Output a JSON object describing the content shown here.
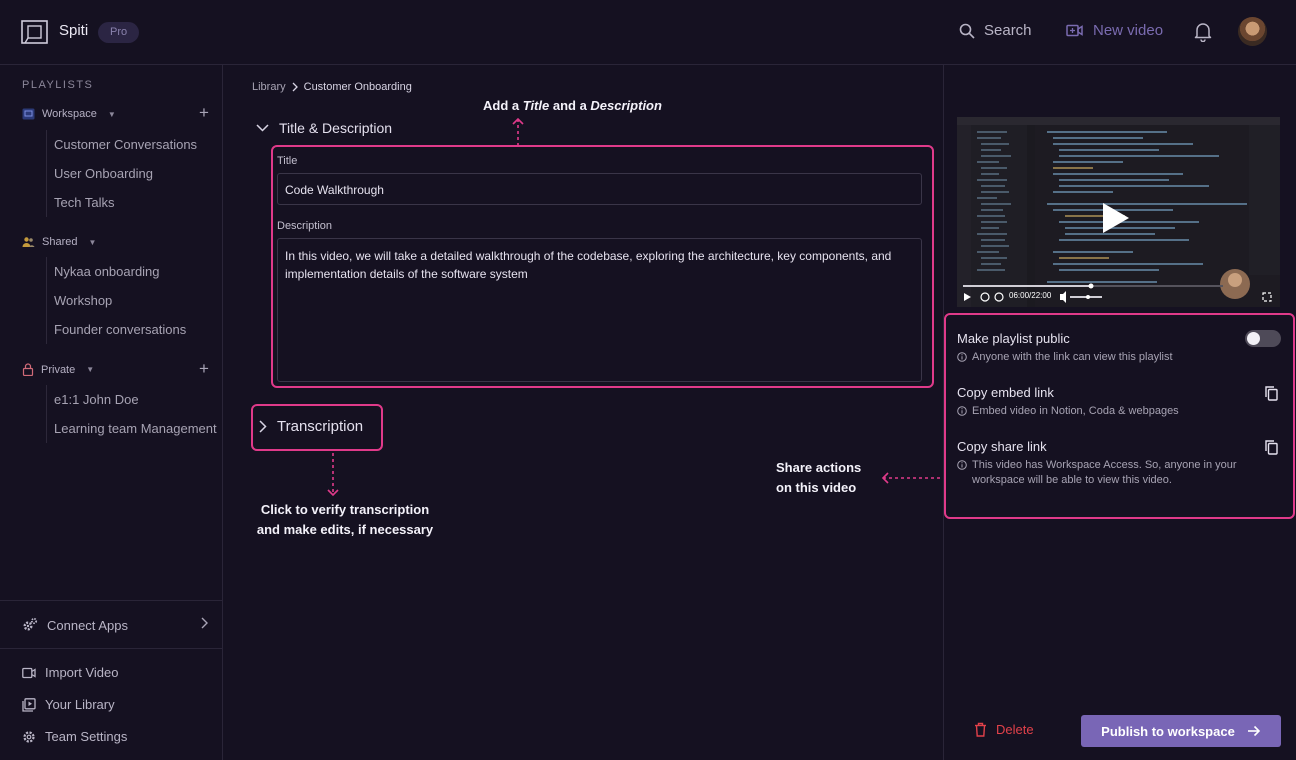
{
  "app": {
    "brand": "Spiti",
    "plan_badge": "Pro"
  },
  "topbar": {
    "search_label": "Search",
    "new_video_label": "New video"
  },
  "sidebar": {
    "heading": "PLAYLISTS",
    "groups": [
      {
        "label": "Workspace",
        "items": [
          "Customer Conversations",
          "User Onboarding",
          "Tech Talks"
        ]
      },
      {
        "label": "Shared",
        "items": [
          "Nykaa onboarding",
          "Workshop",
          "Founder conversations"
        ]
      },
      {
        "label": "Private",
        "items": [
          "e1:1 John Doe",
          "Learning team Management"
        ]
      }
    ],
    "connect_apps": "Connect Apps",
    "import_video": "Import Video",
    "your_library": "Your Library",
    "team_settings": "Team Settings"
  },
  "breadcrumb": {
    "root": "Library",
    "current": "Customer Onboarding"
  },
  "annotations": {
    "title_desc_pre": "Add a ",
    "title_desc_em1": "Title",
    "title_desc_mid": " and a ",
    "title_desc_em2": "Description",
    "transcription_line1": "Click to verify transcription",
    "transcription_line2": "and make edits, if necessary",
    "share_line1": "Share actions",
    "share_line2": "on this video"
  },
  "main": {
    "section_title": "Title & Description",
    "title_label": "Title",
    "title_value": "Code Walkthrough",
    "description_label": "Description",
    "description_value": "In this video, we will take a detailed walkthrough of the codebase, exploring the architecture, key components, and implementation details of the software system",
    "transcription_label": "Transcription"
  },
  "player": {
    "time": "06:00/22:00",
    "progress": 0.27
  },
  "share": {
    "public_title": "Make playlist public",
    "public_sub": "Anyone with the link can view this playlist",
    "public_enabled": false,
    "embed_title": "Copy embed link",
    "embed_sub": "Embed video in Notion, Coda & webpages",
    "share_title": "Copy share link",
    "share_sub_1": "This video has Workspace Access. So, anyone in your",
    "share_sub_2": "workspace will be able to view this video."
  },
  "actions": {
    "delete": "Delete",
    "publish": "Publish to workspace"
  },
  "colors": {
    "accent": "#7966b6",
    "highlight": "#e03a8a",
    "danger": "#e2414a",
    "background": "#151121"
  }
}
